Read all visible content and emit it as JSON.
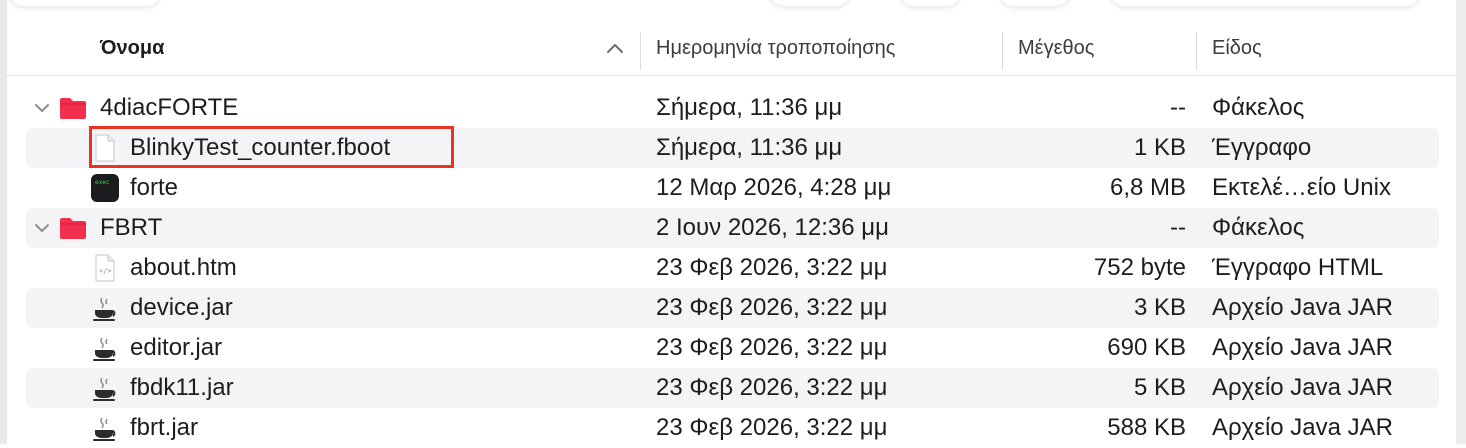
{
  "columns": {
    "name": "Όνομα",
    "date": "Ημερομηνία τροποποίησης",
    "size": "Μέγεθος",
    "kind": "Είδος"
  },
  "rows": [
    {
      "name": "4diacFORTE",
      "date": "Σήμερα, 11:36 μμ",
      "size": "--",
      "kind": "Φάκελος",
      "icon": "folder-icon",
      "expanded": true
    },
    {
      "name": "BlinkyTest_counter.fboot",
      "date": "Σήμερα, 11:36 μμ",
      "size": "1 KB",
      "kind": "Έγγραφο",
      "icon": "document-icon",
      "highlighted": true
    },
    {
      "name": "forte",
      "date": "12 Μαρ 2026, 4:28 μμ",
      "size": "6,8 MB",
      "kind": "Εκτελέ…είο Unix",
      "icon": "terminal-exec-icon"
    },
    {
      "name": "FBRT",
      "date": "2 Ιουν 2026, 12:36 μμ",
      "size": "--",
      "kind": "Φάκελος",
      "icon": "folder-icon",
      "expanded": true
    },
    {
      "name": "about.htm",
      "date": "23 Φεβ 2026, 3:22 μμ",
      "size": "752 byte",
      "kind": "Έγγραφο HTML",
      "icon": "html-document-icon"
    },
    {
      "name": "device.jar",
      "date": "23 Φεβ 2026, 3:22 μμ",
      "size": "3 KB",
      "kind": "Αρχείο Java JAR",
      "icon": "java-jar-icon"
    },
    {
      "name": "editor.jar",
      "date": "23 Φεβ 2026, 3:22 μμ",
      "size": "690 KB",
      "kind": "Αρχείο Java JAR",
      "icon": "java-jar-icon"
    },
    {
      "name": "fbdk11.jar",
      "date": "23 Φεβ 2026, 3:22 μμ",
      "size": "5 KB",
      "kind": "Αρχείο Java JAR",
      "icon": "java-jar-icon"
    },
    {
      "name": "fbrt.jar",
      "date": "23 Φεβ 2026, 3:22 μμ",
      "size": "588 KB",
      "kind": "Αρχείο Java JAR",
      "icon": "java-jar-icon"
    }
  ],
  "colors": {
    "folder": "#f2304d",
    "highlight": "#ea3323",
    "row_alt": "#f4f4f6"
  }
}
